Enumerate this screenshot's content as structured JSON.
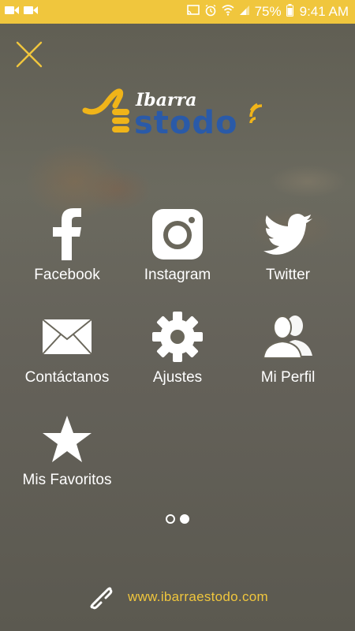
{
  "status_bar": {
    "battery_percent": "75%",
    "time": "9:41 AM",
    "icons": [
      "video-icon",
      "video-icon",
      "cast-icon",
      "alarm-icon",
      "wifi-icon",
      "signal-icon",
      "battery-icon"
    ]
  },
  "colors": {
    "accent": "#f0c63d",
    "brand_blue": "#2a5aa8",
    "text": "#ffffff"
  },
  "logo": {
    "top_text": "Ibarra",
    "bottom_text": "stodo"
  },
  "menu": {
    "items": [
      {
        "label": "Facebook",
        "icon": "facebook-icon"
      },
      {
        "label": "Instagram",
        "icon": "instagram-icon"
      },
      {
        "label": "Twitter",
        "icon": "twitter-icon"
      },
      {
        "label": "Contáctanos",
        "icon": "envelope-icon"
      },
      {
        "label": "Ajustes",
        "icon": "gear-icon"
      },
      {
        "label": "Mi Perfil",
        "icon": "users-icon"
      },
      {
        "label": "Mis Favoritos",
        "icon": "star-icon"
      }
    ]
  },
  "pager": {
    "page_count": 2,
    "current_page": 2
  },
  "footer": {
    "url": "www.ibarraestodo.com"
  }
}
